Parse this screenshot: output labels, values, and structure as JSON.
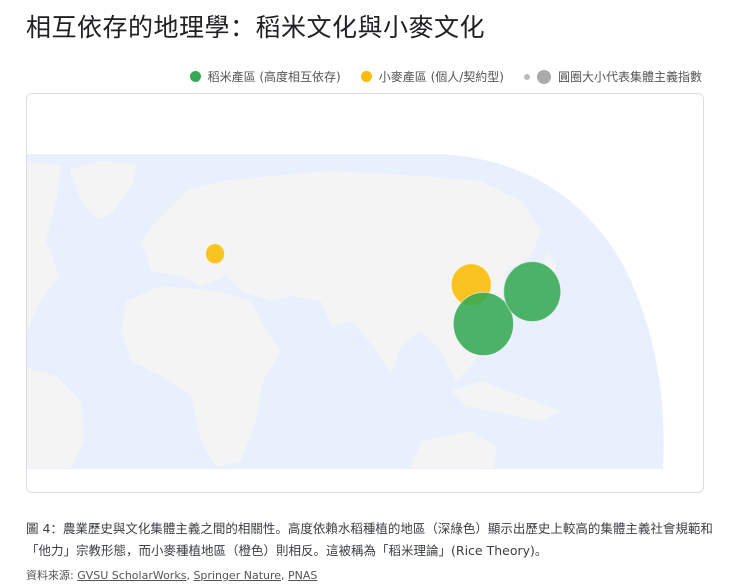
{
  "title": "相互依存的地理學：稻米文化與小麥文化",
  "legend": {
    "rice": "稻米產區 (高度相互依存)",
    "wheat": "小麥產區 (個人/契約型)",
    "size": "圓圈大小代表集體主義指數"
  },
  "colors": {
    "rice": "#34a853",
    "wheat": "#fbbc04",
    "size": "#9e9e9e",
    "ocean": "#e8f0fd",
    "land": "#f4f4f4"
  },
  "chart_data": {
    "type": "scatter",
    "subtype": "geo-bubble",
    "size_meaning": "圓圈大小代表集體主義指數",
    "points": [
      {
        "group": "wheat",
        "lon": 8,
        "lat": 46,
        "value": 30
      },
      {
        "group": "wheat",
        "lon": 113,
        "lat": 37,
        "value": 63
      },
      {
        "group": "rice",
        "lon": 118,
        "lat": 25.6,
        "value": 95
      },
      {
        "group": "rice",
        "lon": 138,
        "lat": 35,
        "value": 90
      }
    ]
  },
  "caption": "圖 4：農業歷史與文化集體主義之間的相關性。高度依賴水稻種植的地區（深綠色）顯示出歷史上較高的集體主義社會規範和「他力」宗教形態，而小麥種植地區（橙色）則相反。這被稱為「稻米理論」(Rice Theory)。",
  "source": {
    "label": "資料來源:",
    "links": [
      "GVSU ScholarWorks",
      "Springer Nature",
      "PNAS"
    ]
  }
}
